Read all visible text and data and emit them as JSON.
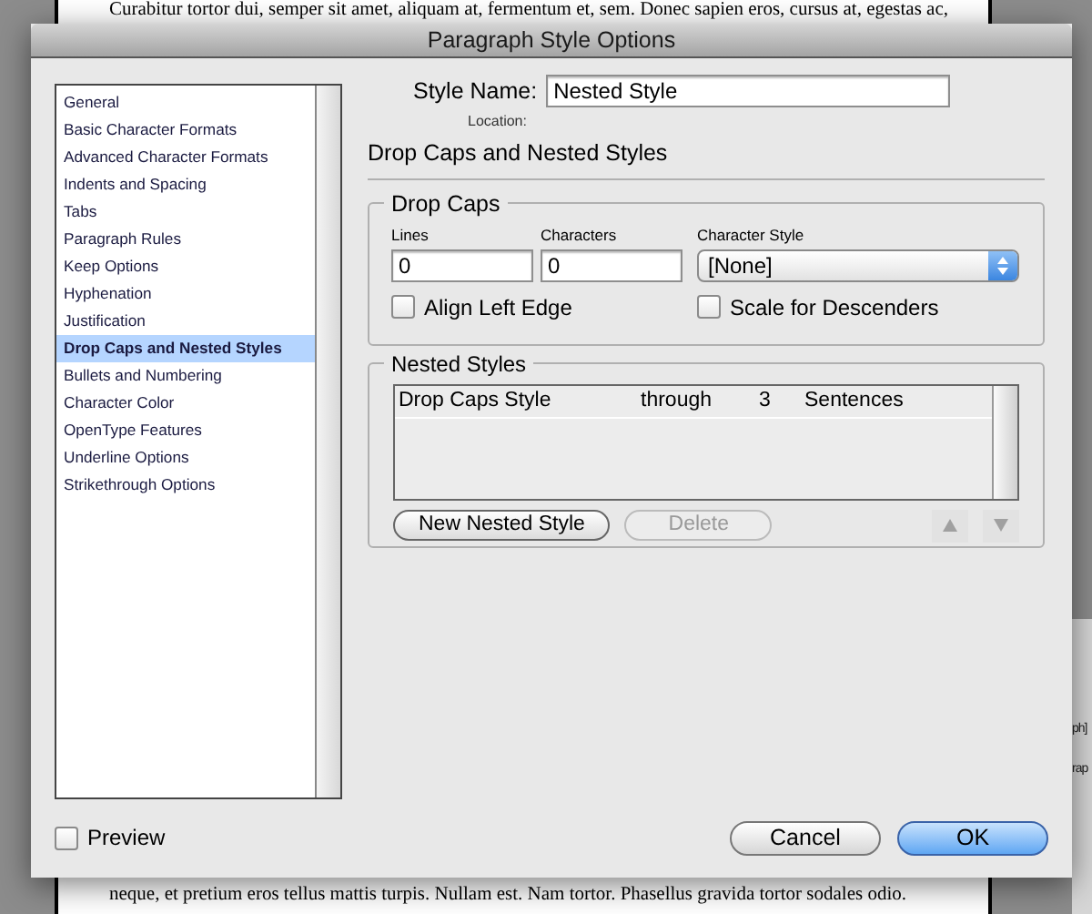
{
  "document": {
    "top_line": "Curabitur tortor dui, semper sit amet, aliquam at, fermentum et, sem. Donec sapien eros, cursus at, egestas ac,",
    "bottom_line": "neque, et pretium eros tellus mattis turpis. Nullam est. Nam tortor. Phasellus gravida tortor sodales odio.",
    "side_fragments": [
      "ph]",
      "rap"
    ]
  },
  "window": {
    "title": "Paragraph Style Options"
  },
  "sidebar": {
    "items": [
      {
        "label": "General",
        "selected": false
      },
      {
        "label": "Basic Character Formats",
        "selected": false
      },
      {
        "label": "Advanced Character Formats",
        "selected": false
      },
      {
        "label": "Indents and Spacing",
        "selected": false
      },
      {
        "label": "Tabs",
        "selected": false
      },
      {
        "label": "Paragraph Rules",
        "selected": false
      },
      {
        "label": "Keep Options",
        "selected": false
      },
      {
        "label": "Hyphenation",
        "selected": false
      },
      {
        "label": "Justification",
        "selected": false
      },
      {
        "label": "Drop Caps and Nested Styles",
        "selected": true
      },
      {
        "label": "Bullets and Numbering",
        "selected": false
      },
      {
        "label": "Character Color",
        "selected": false
      },
      {
        "label": "OpenType Features",
        "selected": false
      },
      {
        "label": "Underline Options",
        "selected": false
      },
      {
        "label": "Strikethrough Options",
        "selected": false
      }
    ]
  },
  "style_name": {
    "label": "Style Name:",
    "value": "Nested Style"
  },
  "location": {
    "label": "Location:"
  },
  "section_title": "Drop Caps and Nested Styles",
  "drop_caps": {
    "title": "Drop Caps",
    "lines": {
      "label": "Lines",
      "value": "0"
    },
    "characters": {
      "label": "Characters",
      "value": "0"
    },
    "character_style": {
      "label": "Character Style",
      "value": "[None]"
    },
    "checkboxes": [
      {
        "label": "Align Left Edge",
        "checked": false
      },
      {
        "label": "Scale for Descenders",
        "checked": false
      }
    ]
  },
  "nested_styles": {
    "title": "Nested Styles",
    "rows": [
      {
        "cells": [
          "Drop Caps Style",
          "through",
          "3",
          "Sentences"
        ],
        "selected": false
      }
    ],
    "buttons": [
      {
        "label": "New Nested Style",
        "disabled": false
      },
      {
        "label": "Delete",
        "disabled": true
      }
    ],
    "move_up_disabled": true,
    "move_down_disabled": true
  },
  "preview": {
    "label": "Preview",
    "checked": false
  },
  "buttons": [
    {
      "label": "Cancel",
      "default": false
    },
    {
      "label": "OK",
      "default": true
    }
  ]
}
